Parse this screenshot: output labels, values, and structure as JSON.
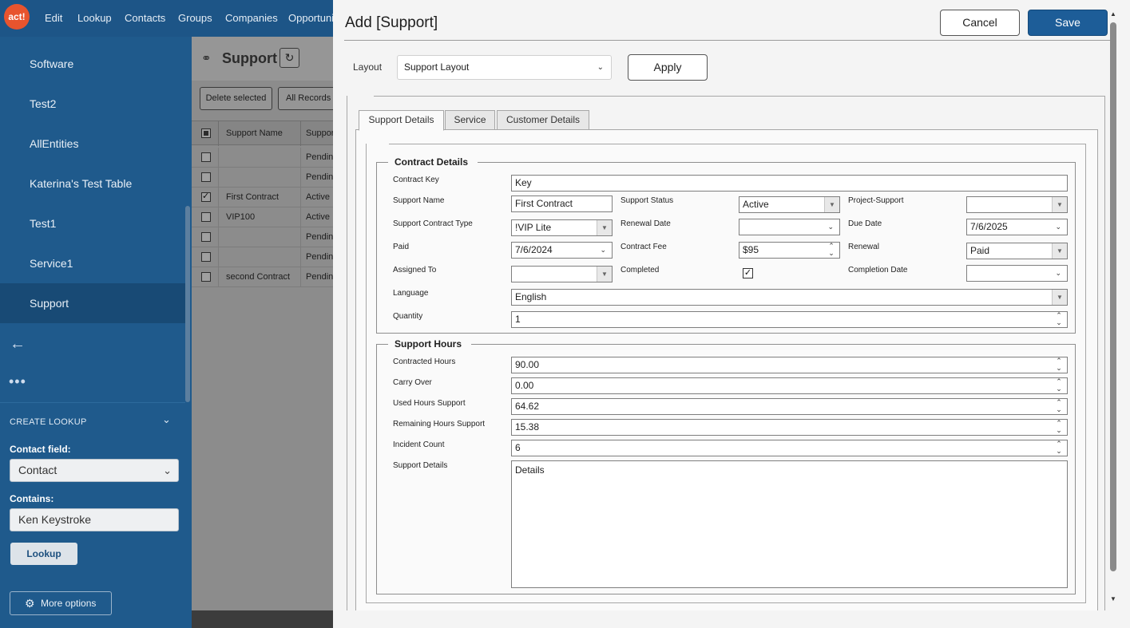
{
  "nav": {
    "logo": "act!",
    "items": [
      "Edit",
      "Lookup",
      "Contacts",
      "Groups",
      "Companies",
      "Opportuni"
    ]
  },
  "sidebar": {
    "items": [
      "Software",
      "Test2",
      "AllEntities",
      "Katerina's Test Table",
      "Test1",
      "Service1",
      "Support"
    ],
    "active": "Support",
    "create_lookup": "CREATE LOOKUP",
    "contact_field_label": "Contact field:",
    "contact_field_value": "Contact",
    "contains_label": "Contains:",
    "contains_value": "Ken Keystroke",
    "lookup_button": "Lookup",
    "more_options_button": "More options"
  },
  "list": {
    "title": "Support",
    "delete_button": "Delete selected",
    "all_records_button": "All Records",
    "columns": [
      "Support Name",
      "Suppor"
    ],
    "rows": [
      {
        "name": "",
        "status": "Pendin",
        "checked": false
      },
      {
        "name": "",
        "status": "Pendin",
        "checked": false
      },
      {
        "name": "First Contract",
        "status": "Active",
        "checked": true
      },
      {
        "name": "VIP100",
        "status": "Active",
        "checked": false
      },
      {
        "name": "",
        "status": "Pendin",
        "checked": false
      },
      {
        "name": "",
        "status": "Pendin",
        "checked": false
      },
      {
        "name": "second Contract",
        "status": "Pendin",
        "checked": false
      }
    ]
  },
  "dialog": {
    "title": "Add [Support]",
    "cancel_button": "Cancel",
    "save_button": "Save",
    "layout_label": "Layout",
    "layout_value": "Support Layout",
    "apply_button": "Apply",
    "tabs": [
      "Support Details",
      "Service",
      "Customer Details"
    ],
    "active_tab": "Support Details",
    "contract_details": {
      "title": "Contract Details",
      "contract_key_label": "Contract Key",
      "contract_key": "Key",
      "support_name_label": "Support Name",
      "support_name": "First Contract",
      "support_status_label": "Support Status",
      "support_status": "Active",
      "project_support_label": "Project-Support",
      "project_support": "",
      "contract_type_label": "Support Contract Type",
      "contract_type": "!VIP Lite",
      "renewal_date_label": "Renewal Date",
      "renewal_date": "",
      "due_date_label": "Due Date",
      "due_date": "7/6/2025",
      "paid_label": "Paid",
      "paid": "7/6/2024",
      "contract_fee_label": "Contract Fee",
      "contract_fee": "$95",
      "renewal_label": "Renewal",
      "renewal": "Paid",
      "assigned_to_label": "Assigned To",
      "assigned_to": "",
      "completed_label": "Completed",
      "completed": true,
      "completion_date_label": "Completion Date",
      "completion_date": "",
      "language_label": "Language",
      "language": "English",
      "quantity_label": "Quantity",
      "quantity": "1"
    },
    "support_hours": {
      "title": "Support Hours",
      "contracted_hours_label": "Contracted Hours",
      "contracted_hours": "90.00",
      "carry_over_label": "Carry Over",
      "carry_over": "0.00",
      "used_hours_label": "Used Hours Support",
      "used_hours": "64.62",
      "remaining_hours_label": "Remaining Hours Support",
      "remaining_hours": "15.38",
      "incident_count_label": "Incident Count",
      "incident_count": "6",
      "support_details_label": "Support Details",
      "support_details": "Details"
    }
  }
}
